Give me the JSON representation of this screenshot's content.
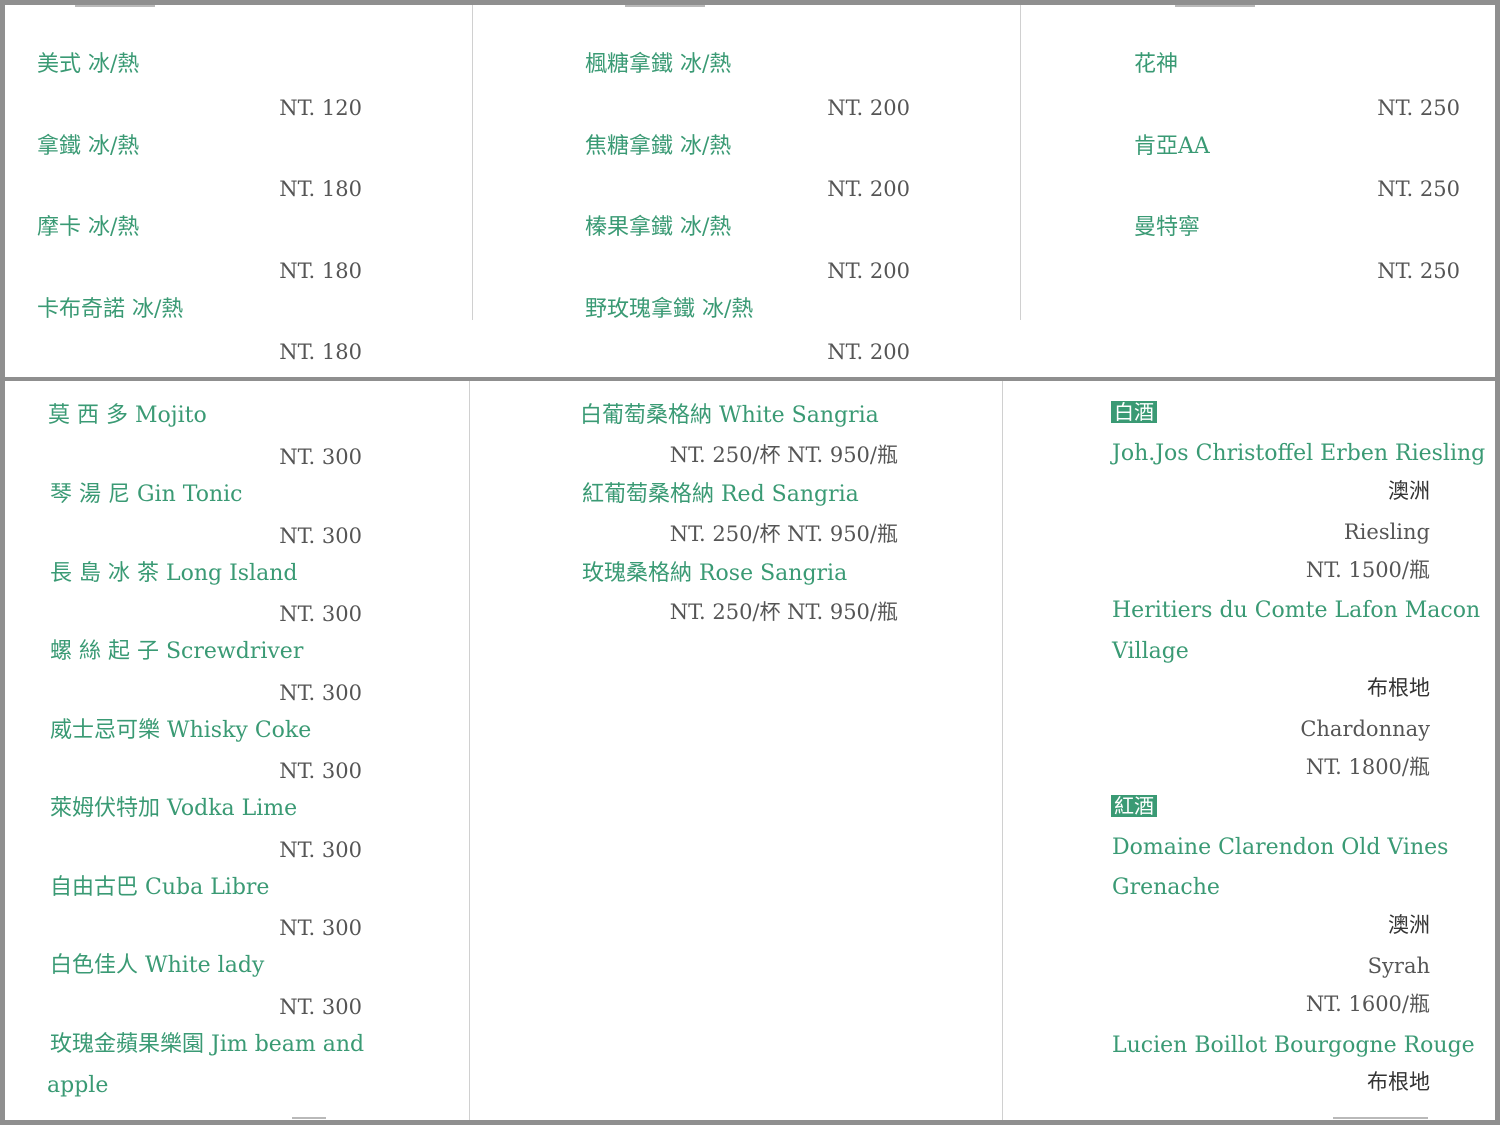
{
  "top": {
    "col1": [
      {
        "name": "美式 冰/熱",
        "price": "NT. 120"
      },
      {
        "name": "拿鐵 冰/熱",
        "price": "NT. 180"
      },
      {
        "name": "摩卡 冰/熱",
        "price": "NT. 180"
      },
      {
        "name": "卡布奇諾 冰/熱",
        "price": "NT. 180"
      }
    ],
    "col2": [
      {
        "name": "楓糖拿鐵 冰/熱",
        "price": "NT. 200"
      },
      {
        "name": "焦糖拿鐵 冰/熱",
        "price": "NT. 200"
      },
      {
        "name": "榛果拿鐵 冰/熱",
        "price": "NT. 200"
      },
      {
        "name": "野玫瑰拿鐵 冰/熱",
        "price": "NT. 200"
      }
    ],
    "col3": [
      {
        "name": "花神",
        "price": "NT. 250"
      },
      {
        "name": "肯亞AA",
        "price": "NT. 250"
      },
      {
        "name": "曼特寧",
        "price": "NT. 250"
      }
    ]
  },
  "cocktails": [
    {
      "name": "莫 西 多 Mojito",
      "price": "NT. 300"
    },
    {
      "name": "琴 湯 尼 Gin Tonic",
      "price": "NT. 300"
    },
    {
      "name": "長 島 冰 茶 Long Island",
      "price": "NT. 300"
    },
    {
      "name": "螺 絲 起 子 Screwdriver",
      "price": "NT. 300"
    },
    {
      "name": "威士忌可樂 Whisky Coke",
      "price": "NT. 300"
    },
    {
      "name": "萊姆伏特加 Vodka Lime",
      "price": "NT. 300"
    },
    {
      "name": "自由古巴 Cuba Libre",
      "price": "NT. 300"
    },
    {
      "name": "白色佳人 White lady",
      "price": "NT. 300"
    },
    {
      "name": "玫瑰金蘋果樂園 Jim beam and",
      "name2": "apple"
    }
  ],
  "sangria": [
    {
      "name": "白葡萄桑格納 White Sangria",
      "price": "NT. 250/杯  NT. 950/瓶"
    },
    {
      "name": "紅葡萄桑格納 Red Sangria",
      "price": "NT. 250/杯  NT. 950/瓶"
    },
    {
      "name": "玫瑰桑格納 Rose Sangria",
      "price": "NT. 250/杯  NT. 950/瓶"
    }
  ],
  "wine": {
    "white_header": "白酒",
    "red_header": "紅酒",
    "white": [
      {
        "name": "Joh.Jos Christoffel Erben Riesling",
        "region": "澳洲",
        "grape": "Riesling",
        "price": "NT. 1500/瓶"
      },
      {
        "name": "Heritiers du Comte Lafon Macon",
        "name2": "Village",
        "region": "布根地",
        "grape": "Chardonnay",
        "price": "NT. 1800/瓶"
      }
    ],
    "red": [
      {
        "name": "Domaine Clarendon Old Vines",
        "name2": "Grenache",
        "region": "澳洲",
        "grape": "Syrah",
        "price": "NT. 1600/瓶"
      },
      {
        "name": "Lucien Boillot Bourgogne Rouge",
        "region": "布根地"
      }
    ]
  }
}
